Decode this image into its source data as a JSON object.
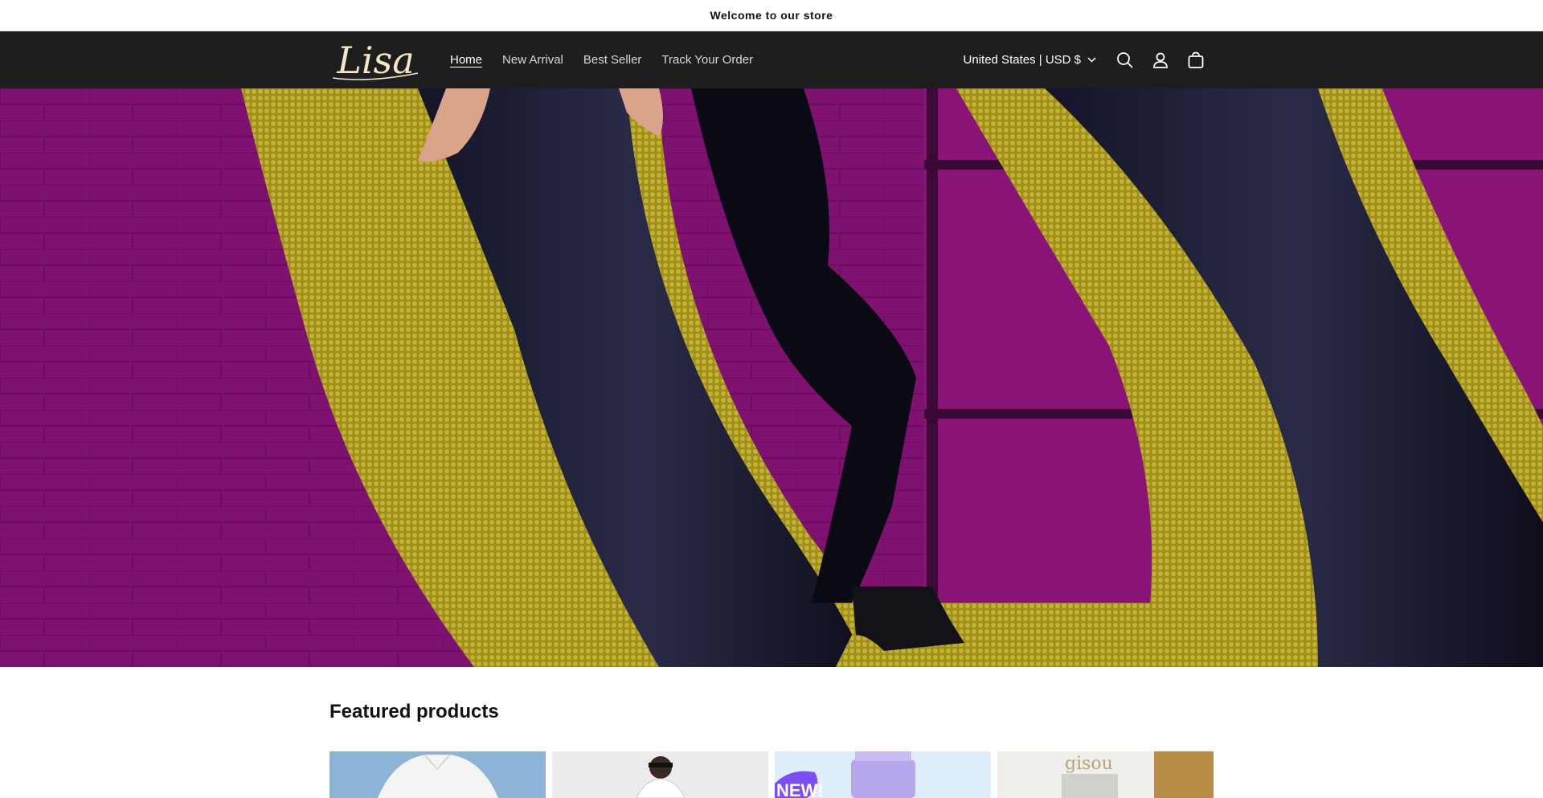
{
  "announcement": {
    "text": "Welcome to our store"
  },
  "header": {
    "logo_text": "Lisa",
    "nav": [
      {
        "label": "Home",
        "active": true
      },
      {
        "label": "New Arrival",
        "active": false
      },
      {
        "label": "Best Seller",
        "active": false
      },
      {
        "label": "Track Your Order",
        "active": false
      }
    ],
    "country_selector": "United States | USD $"
  },
  "featured": {
    "title": "Featured products",
    "products": [
      {
        "name": "white-shirt-product"
      },
      {
        "name": "halter-top-product"
      },
      {
        "name": "lavender-tube-product",
        "badge": "NEW!"
      },
      {
        "name": "gisou-product",
        "brand": "gisou"
      }
    ]
  },
  "colors": {
    "header_bg": "#1e1e1e",
    "hero_magenta": "#7a1268",
    "hero_yellow": "#b7a52a",
    "badge_purple": "#7b4df2"
  }
}
